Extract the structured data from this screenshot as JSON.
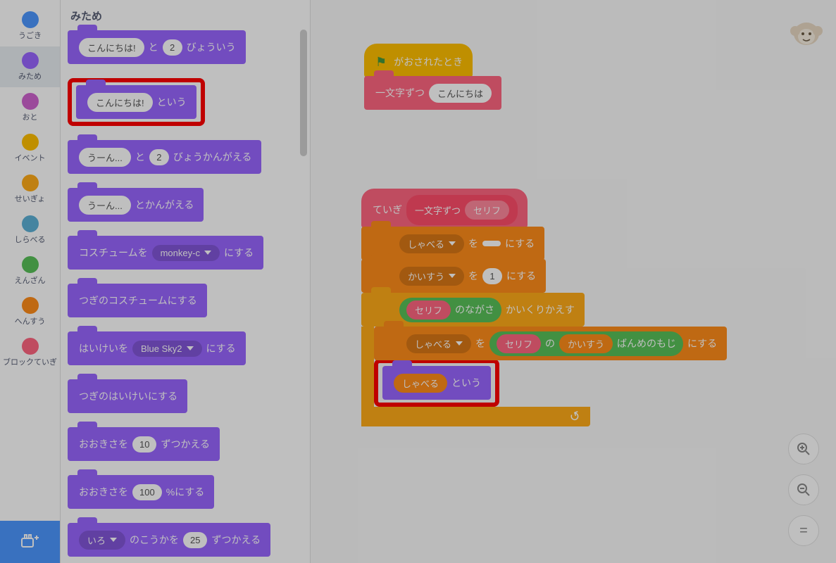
{
  "categories": [
    {
      "id": "motion",
      "label": "うごき",
      "color": "#4C97FF"
    },
    {
      "id": "looks",
      "label": "みため",
      "color": "#9966FF",
      "active": true
    },
    {
      "id": "sound",
      "label": "おと",
      "color": "#CF63CF"
    },
    {
      "id": "events",
      "label": "イベント",
      "color": "#FFBF00"
    },
    {
      "id": "control",
      "label": "せいぎょ",
      "color": "#FFAB19"
    },
    {
      "id": "sensing",
      "label": "しらべる",
      "color": "#5CB1D6"
    },
    {
      "id": "operators",
      "label": "えんざん",
      "color": "#59C059"
    },
    {
      "id": "variables",
      "label": "へんすう",
      "color": "#FF8C1A"
    },
    {
      "id": "myblocks",
      "label": "ブロックていぎ",
      "color": "#FF6680"
    }
  ],
  "palette": {
    "heading": "みため",
    "blocks": {
      "sayFor": {
        "arg": "こんにちは!",
        "join": "と",
        "num": "2",
        "tail": "びょういう"
      },
      "say": {
        "arg": "こんにちは!",
        "tail": "という"
      },
      "thinkFor": {
        "arg": "うーん...",
        "join": "と",
        "num": "2",
        "tail": "びょうかんがえる"
      },
      "think": {
        "arg": "うーん...",
        "tail": "とかんがえる"
      },
      "switchCostume": {
        "pre": "コスチュームを",
        "opt": "monkey-c",
        "tail": "にする"
      },
      "nextCostume": {
        "text": "つぎのコスチュームにする"
      },
      "switchBackdrop": {
        "pre": "はいけいを",
        "opt": "Blue Sky2",
        "tail": "にする"
      },
      "nextBackdrop": {
        "text": "つぎのはいけいにする"
      },
      "changeSize": {
        "pre": "おおきさを",
        "num": "10",
        "tail": "ずつかえる"
      },
      "setSize": {
        "pre": "おおきさを",
        "num": "100",
        "tail": "%にする"
      },
      "changeEffect": {
        "opt": "いろ",
        "mid": "のこうかを",
        "num": "25",
        "tail": "ずつかえる"
      }
    }
  },
  "workspace": {
    "script1": {
      "whenFlag": {
        "tail": "がおされたとき"
      },
      "callOneChar": {
        "name": "一文字ずつ",
        "arg": "こんにちは"
      }
    },
    "script2": {
      "define": {
        "pre": "ていぎ",
        "name": "一文字ずつ",
        "param": "セリフ"
      },
      "setTalk": {
        "var": "しゃべる",
        "mid": "を",
        "val": "",
        "tail": "にする"
      },
      "setCount": {
        "var": "かいすう",
        "mid": "を",
        "val": "1",
        "tail": "にする"
      },
      "repeat": {
        "param": "セリフ",
        "len": "のながさ",
        "tail": "かいくりかえす"
      },
      "setTalk2": {
        "var": "しゃべる",
        "mid": "を",
        "p1": "セリフ",
        "of": "の",
        "p2": "かいすう",
        "suf": "ばんめのもじ",
        "tail": "にする"
      },
      "sayVar": {
        "var": "しゃべる",
        "tail": "という"
      }
    }
  },
  "zoom": {
    "in": "+",
    "out": "−",
    "reset": "="
  }
}
